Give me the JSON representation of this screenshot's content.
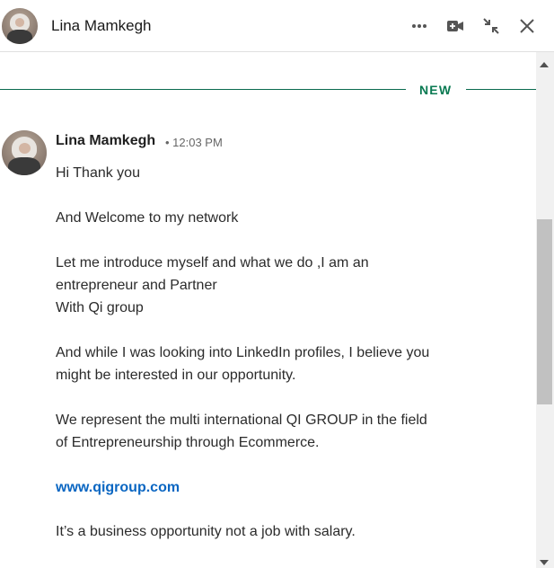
{
  "header": {
    "name": "Lina Mamkegh"
  },
  "divider": {
    "label": "NEW"
  },
  "message": {
    "sender": "Lina Mamkegh",
    "time": "• 12:03 PM",
    "lines": [
      "Hi Thank you",
      "And Welcome to my network",
      "Let me introduce myself and what we do ,I am an",
      "entrepreneur and Partner",
      "With Qi group",
      "And while I was looking into LinkedIn profiles, I believe you",
      "might be interested in our opportunity.",
      "We represent the multi international QI GROUP in the field",
      "of Entrepreneurship through Ecommerce.",
      "www.qigroup.com",
      "It’s a business opportunity not a job with salary."
    ]
  },
  "icons": {
    "more": "more-icon",
    "video": "video-call-icon",
    "minimize": "minimize-icon",
    "close": "close-icon"
  }
}
